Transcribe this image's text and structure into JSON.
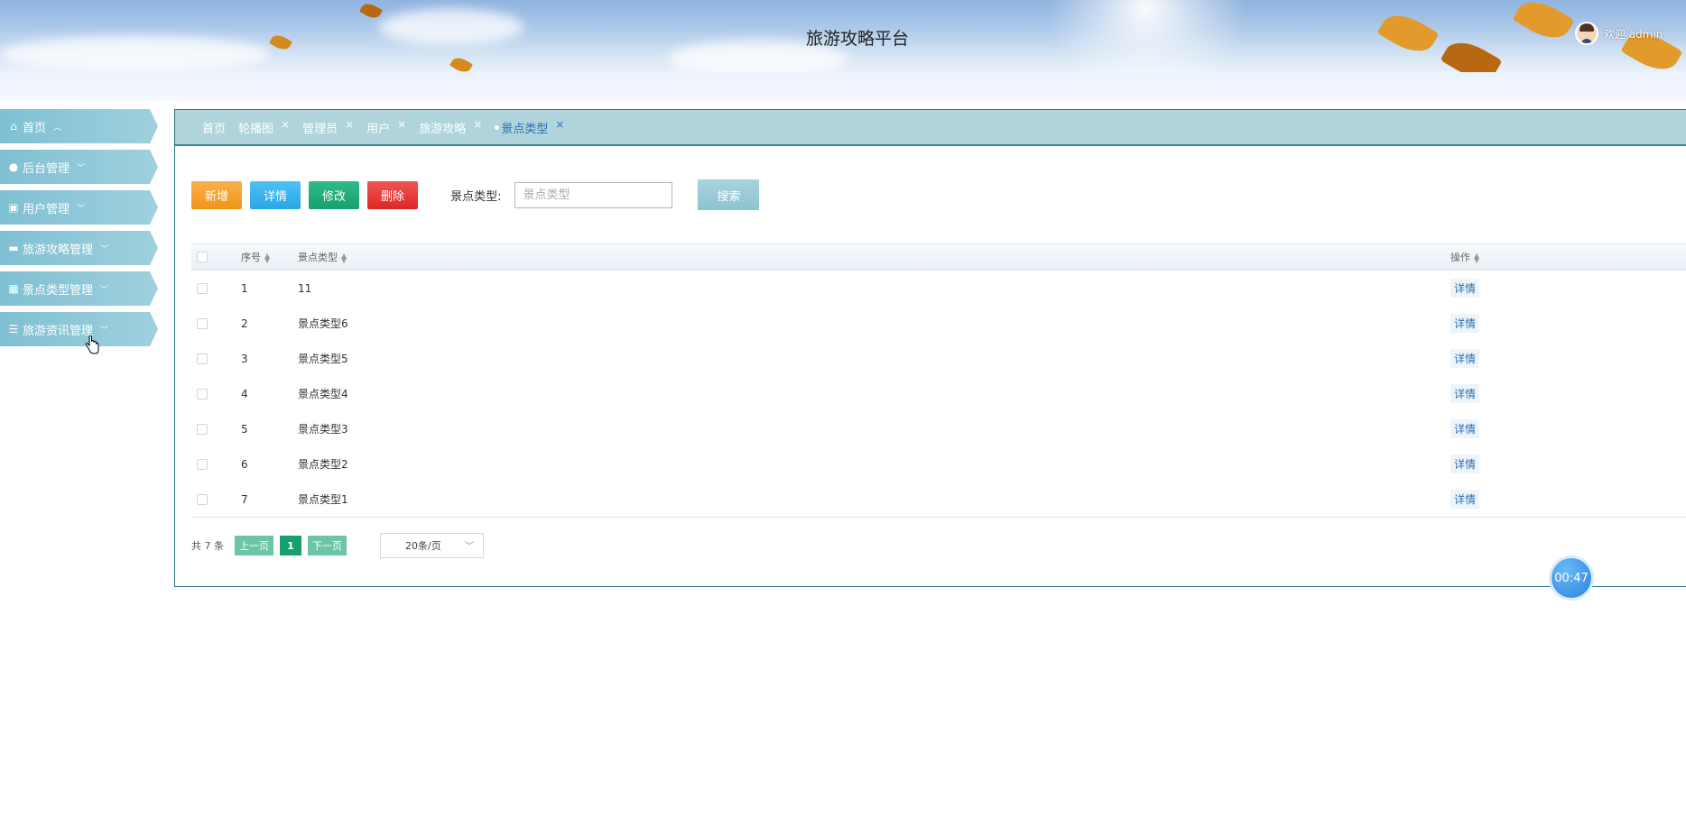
{
  "header": {
    "title": "旅游攻略平台",
    "welcome": "欢迎 admin"
  },
  "sidebar": {
    "items": [
      {
        "label": "首页",
        "icon": "home-icon",
        "chevron": "^"
      },
      {
        "label": "后台管理",
        "icon": "dots-icon",
        "chevron": "v"
      },
      {
        "label": "用户管理",
        "icon": "user-card-icon",
        "chevron": "v"
      },
      {
        "label": "旅游攻略管理",
        "icon": "picture-icon",
        "chevron": "v"
      },
      {
        "label": "景点类型管理",
        "icon": "building-icon",
        "chevron": "v"
      },
      {
        "label": "旅游资讯管理",
        "icon": "list-icon",
        "chevron": "v"
      }
    ]
  },
  "tabs": [
    {
      "label": "首页",
      "closable": false
    },
    {
      "label": "轮播图",
      "closable": true
    },
    {
      "label": "管理员",
      "closable": true
    },
    {
      "label": "用户",
      "closable": true
    },
    {
      "label": "旅游攻略",
      "closable": true
    },
    {
      "label": "景点类型",
      "closable": true,
      "active": true
    }
  ],
  "toolbar": {
    "add_label": "新增",
    "detail_label": "详情",
    "edit_label": "修改",
    "delete_label": "删除",
    "search_label": "景点类型:",
    "search_placeholder": "景点类型",
    "search_value": "",
    "search_button": "搜索"
  },
  "table": {
    "headers": {
      "no": "序号",
      "type": "景点类型",
      "op": "操作"
    },
    "rows": [
      {
        "no": "1",
        "type": "11",
        "op": "详情"
      },
      {
        "no": "2",
        "type": "景点类型6",
        "op": "详情"
      },
      {
        "no": "3",
        "type": "景点类型5",
        "op": "详情"
      },
      {
        "no": "4",
        "type": "景点类型4",
        "op": "详情"
      },
      {
        "no": "5",
        "type": "景点类型3",
        "op": "详情"
      },
      {
        "no": "6",
        "type": "景点类型2",
        "op": "详情"
      },
      {
        "no": "7",
        "type": "景点类型1",
        "op": "详情"
      }
    ]
  },
  "pager": {
    "total": "共 7 条",
    "prev": "上一页",
    "page": "1",
    "next": "下一页",
    "page_size": "20条/页"
  },
  "timer": "00:47"
}
